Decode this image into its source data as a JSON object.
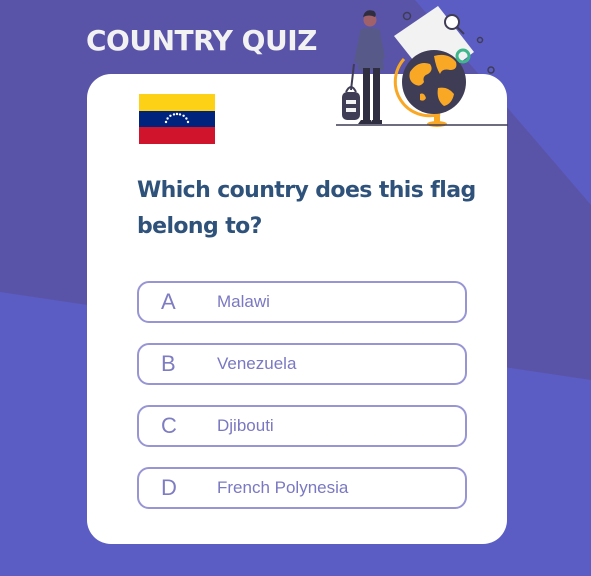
{
  "app": {
    "title": "COUNTRY QUIZ"
  },
  "question": {
    "text": "Which country does this flag belong to?",
    "flag_icon": "venezuela-flag-icon"
  },
  "answers": [
    {
      "letter": "A",
      "label": "Malawi"
    },
    {
      "letter": "B",
      "label": "Venezuela"
    },
    {
      "letter": "C",
      "label": "Djibouti"
    },
    {
      "letter": "D",
      "label": "French Polynesia"
    }
  ],
  "colors": {
    "background": "#5b5dc4",
    "card": "#ffffff",
    "title": "#f2f2f2",
    "question": "#2f527b",
    "answer_border": "#9795d4",
    "answer_text": "#7a78c2"
  }
}
